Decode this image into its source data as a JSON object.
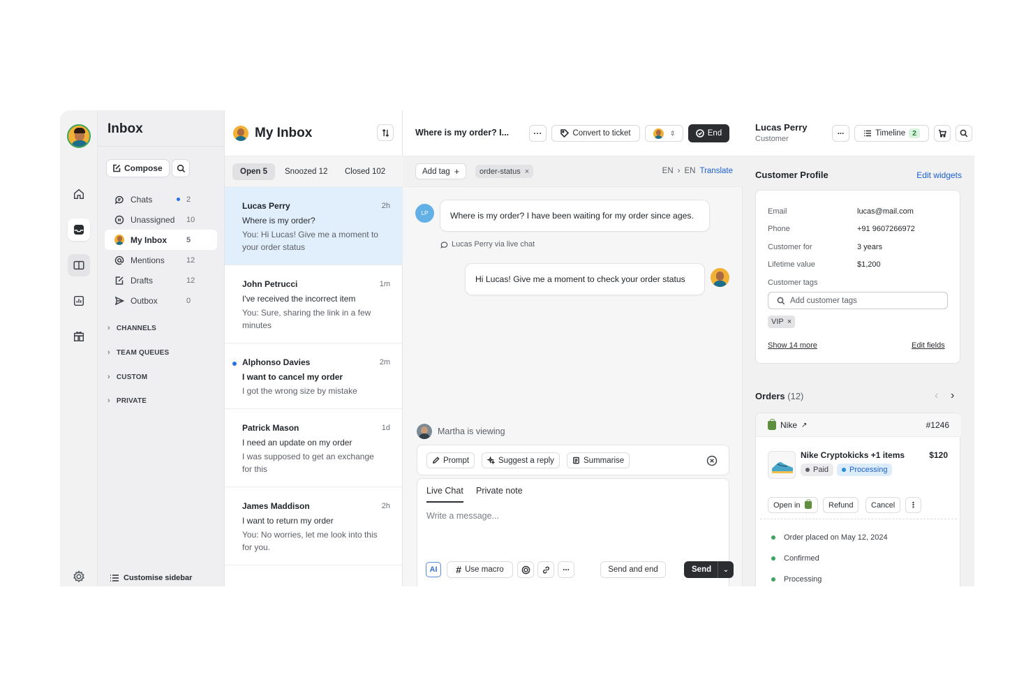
{
  "sidebar": {
    "title": "Inbox",
    "compose_label": "Compose",
    "nav": [
      {
        "label": "Chats",
        "count": "2"
      },
      {
        "label": "Unassigned",
        "count": "10"
      },
      {
        "label": "My Inbox",
        "count": "5"
      },
      {
        "label": "Mentions",
        "count": "12"
      },
      {
        "label": "Drafts",
        "count": "12"
      },
      {
        "label": "Outbox",
        "count": "0"
      }
    ],
    "groups": [
      "CHANNELS",
      "TEAM QUEUES",
      "CUSTOM",
      "PRIVATE"
    ],
    "customise_label": "Customise sidebar"
  },
  "inbox": {
    "title": "My Inbox",
    "tabs": [
      "Open 5",
      "Snoozed 12",
      "Closed 102"
    ],
    "conversations": [
      {
        "name": "Lucas Perry",
        "time": "2h",
        "subject": "Where is my order?",
        "preview": "You: Hi Lucas! Give me  a moment to your order status"
      },
      {
        "name": "John Petrucci",
        "time": "1m",
        "subject": "I've received the incorrect item",
        "preview": "You: Sure, sharing the link in a few minutes"
      },
      {
        "name": "Alphonso Davies",
        "time": "2m",
        "subject": "I want to cancel my order",
        "preview": "I got the wrong size by mistake"
      },
      {
        "name": "Patrick Mason",
        "time": "1d",
        "subject": "I need an update on my order",
        "preview": "I was supposed to get an exchange for this"
      },
      {
        "name": "James Maddison",
        "time": "2h",
        "subject": "I want to return my order",
        "preview": "You: No worries, let me look into this for you."
      }
    ]
  },
  "chat": {
    "title": "Where is my order? I...",
    "convert_label": "Convert to ticket",
    "end_label": "End",
    "add_tag_label": "Add tag",
    "tag": "order-status",
    "lang_from": "EN",
    "lang_to": "EN",
    "translate_label": "Translate",
    "customer_initials": "LP",
    "customer_message": "Where is my order? I have been waiting for my order since ages.",
    "via_label": "Lucas Perry via live chat",
    "agent_message": "Hi Lucas! Give me  a moment to check your order status",
    "viewing_label": "Martha is viewing",
    "ai_actions": [
      "Prompt",
      "Suggest a reply",
      "Summarise"
    ],
    "composer_tabs": [
      "Live Chat",
      "Private note"
    ],
    "composer_placeholder": "Write a message...",
    "ai_tag": "AI",
    "macro_label": "Use macro",
    "send_end_label": "Send and end",
    "send_label": "Send"
  },
  "customer": {
    "name": "Lucas Perry",
    "role": "Customer",
    "timeline_label": "Timeline",
    "timeline_count": "2",
    "profile_title": "Customer Profile",
    "edit_widgets_label": "Edit widgets",
    "fields": [
      {
        "label": "Email",
        "value": "lucas@mail.com"
      },
      {
        "label": "Phone",
        "value": "+91 9607266972"
      },
      {
        "label": "Customer for",
        "value": "3 years"
      },
      {
        "label": "Lifetime value",
        "value": "$1,200"
      }
    ],
    "tags_label": "Customer tags",
    "tags_placeholder": "Add customer tags",
    "tags": [
      "VIP"
    ],
    "show_more_label": "Show 14 more",
    "edit_fields_label": "Edit fields"
  },
  "orders": {
    "title": "Orders",
    "count": "(12)",
    "store": "Nike",
    "order_id": "#1246",
    "product": "Nike Cryptokicks +1 items",
    "price": "$120",
    "payment_status": "Paid",
    "fulfillment_status": "Processing",
    "actions": [
      "Open in",
      "Refund",
      "Cancel"
    ],
    "timeline": [
      "Order placed on May 12, 2024",
      "Confirmed",
      "Processing"
    ]
  }
}
